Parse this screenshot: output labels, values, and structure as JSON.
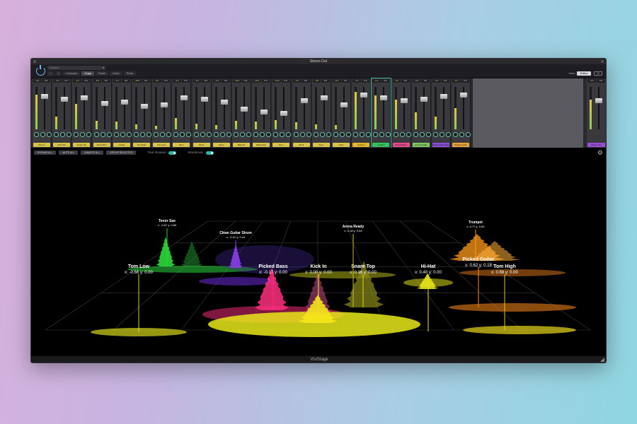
{
  "window": {
    "title": "Stereo Out",
    "footer": "VisiStage"
  },
  "toolbar": {
    "preset": "Default",
    "nav_prev": "<",
    "nav_next": ">",
    "buttons": [
      "Compare",
      "Copy",
      "Paste",
      "Undo",
      "Redo"
    ],
    "active_button": "Copy",
    "view_label": "View:",
    "view_value": "Editor",
    "link_label": "⊘"
  },
  "mixer": {
    "strips": [
      {
        "name": "Kick In",
        "color": "#d8c24a",
        "db": "-3.6"
      },
      {
        "name": "Kick Out",
        "color": "#d8c24a",
        "db": "-4.2"
      },
      {
        "name": "Snare Top",
        "color": "#d8c24a",
        "db": "-1.6"
      },
      {
        "name": "Snare Btm",
        "color": "#d8c24a",
        "db": "-4.6"
      },
      {
        "name": "Hi-Hat",
        "color": "#d8c24a",
        "db": "-5.1"
      },
      {
        "name": "Tom High",
        "color": "#d8c24a",
        "db": "-10.6"
      },
      {
        "name": "Tom Low",
        "color": "#d8c24a",
        "db": "-8.1"
      },
      {
        "name": "OH L",
        "color": "#d8c24a",
        "db": "-3.4"
      },
      {
        "name": "OH R",
        "color": "#d8c24a",
        "db": "-4.0"
      },
      {
        "name": "Room",
        "color": "#d8c24a",
        "db": "-5.2"
      },
      {
        "name": "Bass DI",
        "color": "#d8c24a",
        "db": "-12.0"
      },
      {
        "name": "Bass Amp",
        "color": "#d8c24a",
        "db": "-16.1"
      },
      {
        "name": "Gtr L",
        "color": "#d8c24a",
        "db": "-14.0"
      },
      {
        "name": "Gtr R",
        "color": "#d8c24a",
        "db": "-3.5"
      },
      {
        "name": "Keys",
        "color": "#d8c24a",
        "db": "-2.8"
      },
      {
        "name": "Pad",
        "color": "#d8c24a",
        "db": "-8.1"
      },
      {
        "name": "Vocal 1",
        "color": "#e3b72b",
        "db": "-2.5"
      },
      {
        "name": "Vocal 2",
        "color": "#37c25f",
        "db": "-6.1"
      },
      {
        "name": "Picked Bass",
        "color": "#e84b8b",
        "db": "-4.0"
      },
      {
        "name": "Arena Ready",
        "color": "#7fc75f",
        "db": "-3.2"
      },
      {
        "name": "Clean Guitar Strum",
        "color": "#8a4fd6",
        "db": "-1.0"
      },
      {
        "name": "Picked Guitar",
        "color": "#e8a33b",
        "db": "-0.7"
      }
    ],
    "master": {
      "name": "Stereo Out",
      "color": "#9b4fd6",
      "db": "-0.6"
    }
  },
  "controls": {
    "buttons": [
      "EXPAND ALL",
      "MUTE ALL",
      "UNMUTE ALL",
      "GROUP SELECTED"
    ],
    "toggle1_label": "TRUE PEAKING",
    "toggle2_label": "REVERB MIX"
  },
  "instruments": [
    {
      "name": "Tom Low",
      "coords": "x: -0.66  y: 0.00",
      "color": "#d6d62c"
    },
    {
      "name": "Clean Guitar Strum",
      "coords": "x: -0.41  y: 0.44",
      "color": "#8a3fe6"
    },
    {
      "name": "Picked Bass",
      "coords": "x: -0.17  y: 0.00",
      "color": "#ff2e7e"
    },
    {
      "name": "Snare Top",
      "coords": "x: 0.16  y: 0.00",
      "color": "#d8d81e"
    },
    {
      "name": "Arena Ready",
      "coords": "x: 0.18  y: 0.54",
      "color": "#c4c41a"
    },
    {
      "name": "Hi-Hat",
      "coords": "x: 0.40  y: 0.00",
      "color": "#e6e61a"
    },
    {
      "name": "Picked Guitar",
      "coords": "x: 0.62  y: 0.18",
      "color": "#ff8a1a"
    },
    {
      "name": "Tom High",
      "coords": "x: 0.68  y: 0.00",
      "color": "#e6c81a"
    },
    {
      "name": "Kick In",
      "coords": "x: 0.00  y: 0.00",
      "color": "#f5e61a"
    },
    {
      "name": "Tenor Sax",
      "coords": "x: -0.67  y: 0.60",
      "color": "#28d63c"
    },
    {
      "name": "Trumpet",
      "coords": "x: 0.77  y: 0.60",
      "color": "#ff9a1a"
    }
  ]
}
